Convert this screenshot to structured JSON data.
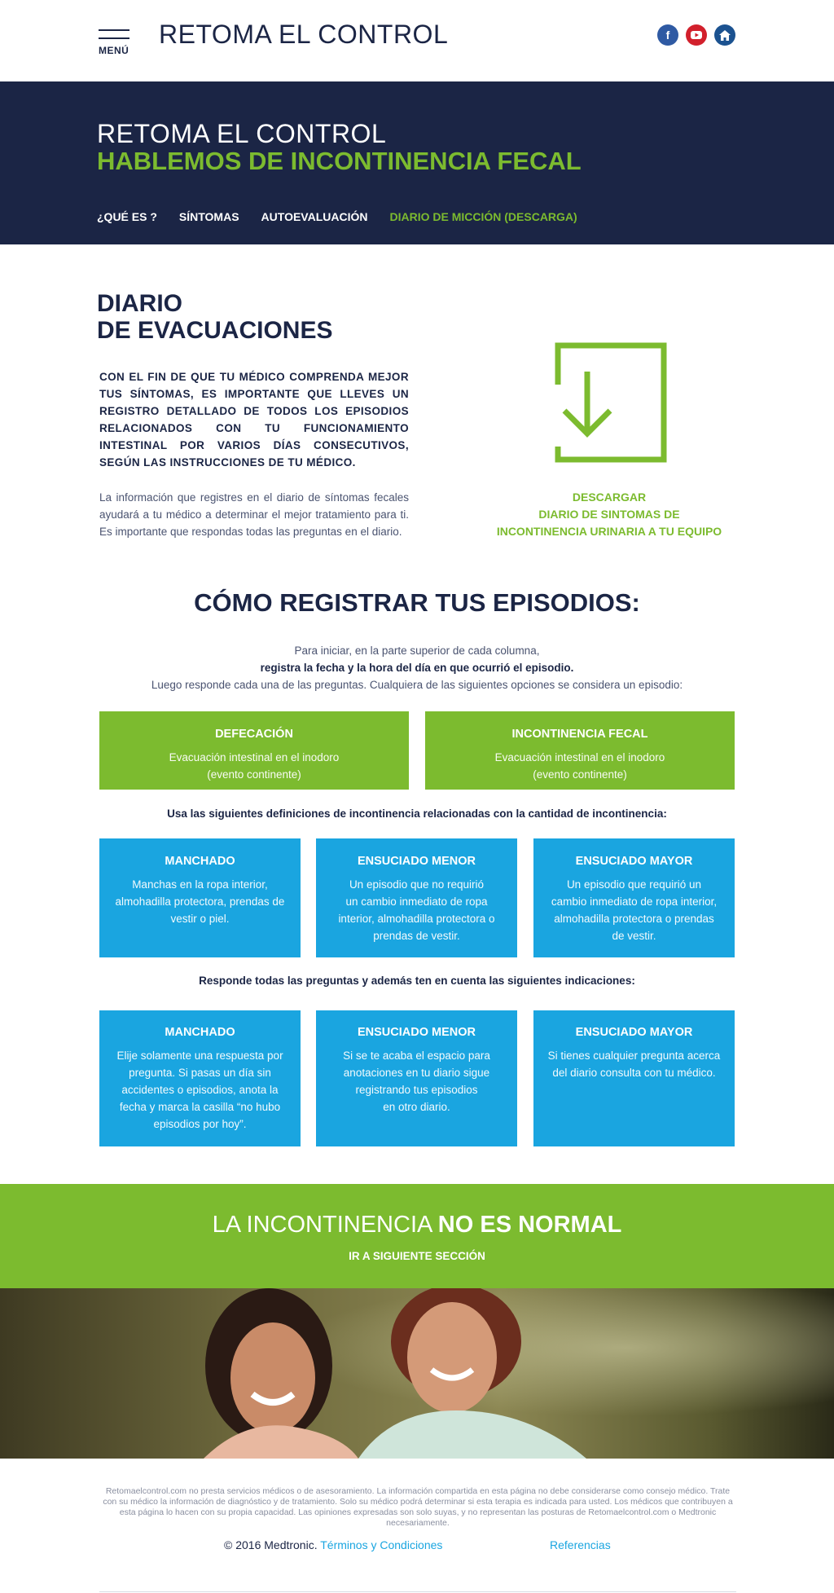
{
  "header": {
    "menu_label": "MENÚ",
    "site_title": "RETOMA EL CONTROL",
    "social": [
      "facebook-icon",
      "youtube-icon",
      "home-icon"
    ]
  },
  "hero": {
    "line1": "RETOMA EL CONTROL",
    "line2": "HABLEMOS DE INCONTINENCIA FECAL",
    "nav": [
      "¿QUÉ ES ?",
      "SÍNTOMAS",
      "AUTOEVALUACIÓN",
      "DIARIO DE MICCIÓN  (DESCARGA)"
    ]
  },
  "diary": {
    "title_line1": "DIARIO",
    "title_line2": "DE EVACUACIONES",
    "lead": "CON EL FIN DE QUE TU MÉDICO COMPRENDA MEJOR TUS SÍNTOMAS, ES IMPORTANTE QUE LLEVES UN REGISTRO DETALLADO DE TODOS LOS EPISODIOS RELACIONADOS CON TU FUNCIONAMIENTO INTESTINAL POR VARIOS DÍAS CONSECUTIVOS, SEGÚN LAS INSTRUCCIONES DE TU MÉDICO.",
    "body": "La información que registres en el diario de síntomas fecales ayudará a tu médico a determinar el mejor tratamiento para ti. Es importante que respondas todas las preguntas en el diario.",
    "download_line1": "DESCARGAR",
    "download_line2": "DIARIO DE SINTOMAS DE",
    "download_line3": "INCONTINENCIA URINARIA A TU EQUIPO"
  },
  "how": {
    "title": "CÓMO REGISTRAR TUS EPISODIOS:",
    "line1": "Para iniciar, en la parte superior de cada columna,",
    "line2": "registra la fecha y la hora del día en que ocurrió el episodio.",
    "line3": "Luego responde cada una de las preguntas. Cualquiera de las siguientes opciones se considera un episodio:"
  },
  "episode_cards": [
    {
      "title": "DEFECACIÓN",
      "line1": "Evacuación intestinal en el inodoro",
      "line2": "(evento continente)"
    },
    {
      "title": "INCONTINENCIA FECAL",
      "line1": "Evacuación intestinal en el inodoro",
      "line2": "(evento continente)"
    }
  ],
  "definitions_heading": "Usa las siguientes definiciones de incontinencia relacionadas con la cantidad de incontinencia:",
  "definition_cards": [
    {
      "title": "MANCHADO",
      "lines": [
        "Manchas en la ropa interior,",
        "almohadilla protectora, prendas de",
        "vestir o piel."
      ]
    },
    {
      "title": "ENSUCIADO MENOR",
      "lines": [
        "Un episodio que no requirió",
        "un cambio inmediato de ropa",
        "interior, almohadilla protectora o",
        "prendas de vestir."
      ]
    },
    {
      "title": "ENSUCIADO MAYOR",
      "lines": [
        "Un episodio que requirió un",
        "cambio inmediato de ropa interior,",
        "almohadilla protectora o prendas",
        "de vestir."
      ]
    }
  ],
  "instructions_heading": "Responde todas las preguntas y además ten en cuenta las siguientes indicaciones:",
  "instruction_cards": [
    {
      "title": "MANCHADO",
      "lines": [
        "Elije solamente una respuesta por",
        "pregunta. Si pasas un día sin",
        "accidentes o episodios, anota la",
        "fecha y marca la casilla “no hubo",
        "episodios por hoy”."
      ]
    },
    {
      "title": "ENSUCIADO MENOR",
      "lines": [
        "Si se te acaba el espacio para",
        "anotaciones en tu diario sigue",
        "registrando tus episodios",
        "en otro diario."
      ]
    },
    {
      "title": "ENSUCIADO MAYOR",
      "lines": [
        "Si tienes cualquier pregunta acerca",
        "del diario consulta con tu médico."
      ]
    }
  ],
  "cta": {
    "light": "LA INCONTINENCIA ",
    "bold": "NO ES NORMAL",
    "link": "IR A SIGUIENTE SECCIÓN"
  },
  "footer": {
    "disclaimer": "Retomaelcontrol.com no presta servicios médicos o de asesoramiento. La información compartida en esta página no debe considerarse como consejo médico. Trate con su médico la información de diagnóstico y de tratamiento. Solo su médico podrá determinar si esta terapia es indicada para usted. Los médicos que contribuyen a esta página lo hacen con su propia capacidad. Las opiniones expresadas son solo suyas, y no representan las posturas de Retomaelcontrol.com o Medtronic necesariamente.",
    "copyright": "© 2016 Medtronic. ",
    "terms": "Términos y Condiciones",
    "references": "Referencias"
  },
  "colors": {
    "navy": "#1b2545",
    "green": "#7cbb2f",
    "blue": "#1aa5e0"
  }
}
